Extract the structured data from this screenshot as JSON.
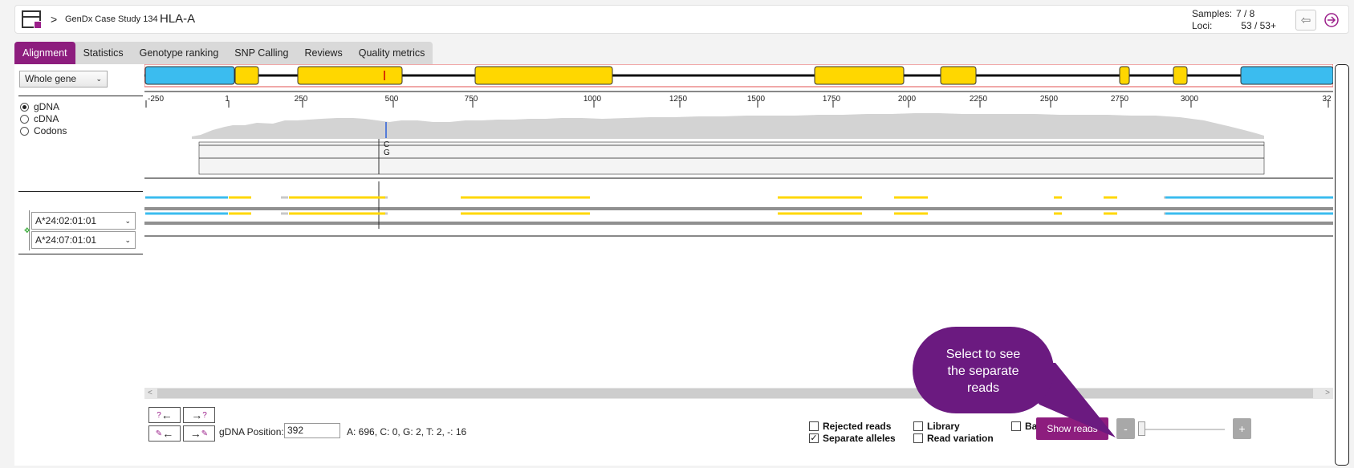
{
  "header": {
    "crumb_sep": ">",
    "case_name": "GenDx Case Study 134",
    "locus": "HLA-A",
    "samples_label": "Samples:",
    "samples_value": "7 / 8",
    "loci_label": "Loci:",
    "loci_value": "53 / 53+",
    "prev_icon": "arrow-left-circle-icon",
    "next_icon": "arrow-right-circle-icon"
  },
  "tabs": [
    {
      "label": "Alignment",
      "active": true
    },
    {
      "label": "Statistics"
    },
    {
      "label": "Genotype ranking"
    },
    {
      "label": "SNP Calling"
    },
    {
      "label": "Reviews"
    },
    {
      "label": "Quality metrics"
    }
  ],
  "left": {
    "view_select": "Whole gene",
    "radios": [
      {
        "label": "gDNA",
        "checked": true
      },
      {
        "label": "cDNA",
        "checked": false
      },
      {
        "label": "Codons",
        "checked": false
      }
    ],
    "alleles": [
      "A*24:02:01:01",
      "A*24:07:01:01"
    ]
  },
  "ruler": {
    "ticks": [
      "-250",
      "1",
      "250",
      "500",
      "750",
      "1000",
      "1250",
      "1500",
      "1750",
      "2000",
      "2250",
      "2500",
      "2750",
      "3000",
      "32"
    ]
  },
  "snp": {
    "top": "C",
    "bottom": "G"
  },
  "bottom": {
    "position_label": "gDNA Position:",
    "position_value": "392",
    "base_counts": "A:  696, C:  0, G:  2, T:  2, -:  16",
    "rejected_reads": "Rejected reads",
    "separate_alleles": "Separate alleles",
    "library": "Library",
    "read_variation": "Read variation",
    "base_variation": "Base variation",
    "show_reads": "Show reads",
    "zoom_out": "-",
    "zoom_in": "+"
  },
  "callout": {
    "text_line1": "Select to see",
    "text_line2": "the separate",
    "text_line3": "reads"
  },
  "colors": {
    "accent": "#8d1d7e",
    "exon": "#ffd700",
    "utr": "#3bbcef",
    "callout": "#6b1a80"
  }
}
